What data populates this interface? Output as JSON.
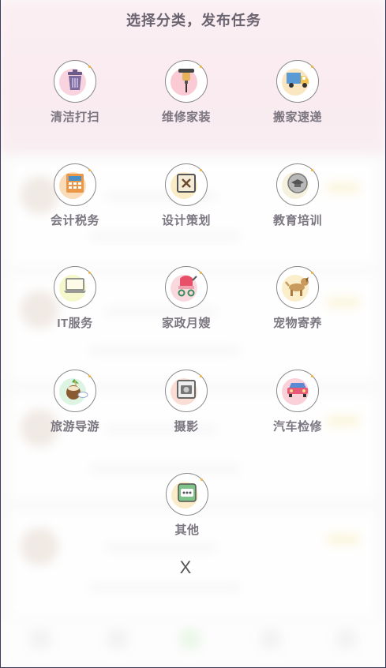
{
  "title": "选择分类，发布任务",
  "categories": [
    {
      "label": "清洁打扫",
      "icon": "trash-can-icon",
      "glow": "#f5b5c8"
    },
    {
      "label": "维修家装",
      "icon": "drill-icon",
      "glow": "#f7a8b8"
    },
    {
      "label": "搬家速递",
      "icon": "moving-truck-icon",
      "glow": "#f7d79a"
    },
    {
      "label": "会计税务",
      "icon": "calculator-icon",
      "glow": "#f7c58a"
    },
    {
      "label": "设计策划",
      "icon": "design-board-icon",
      "glow": "#f7e1a0"
    },
    {
      "label": "教育培训",
      "icon": "graduation-cap-icon",
      "glow": "#f0e7c8"
    },
    {
      "label": "IT服务",
      "icon": "laptop-icon",
      "glow": "#eef3a8"
    },
    {
      "label": "家政月嫂",
      "icon": "baby-stroller-icon",
      "glow": "#f7c0c8"
    },
    {
      "label": "宠物寄养",
      "icon": "dog-icon",
      "glow": "#f7e3a8"
    },
    {
      "label": "旅游导游",
      "icon": "coconut-drink-icon",
      "glow": "#c8ecd0"
    },
    {
      "label": "摄影",
      "icon": "camera-icon",
      "glow": "#f7c6b8"
    },
    {
      "label": "汽车检修",
      "icon": "car-icon",
      "glow": "#f7b0c0"
    },
    {
      "label": "其他",
      "icon": "more-dots-icon",
      "glow": "#f6dfa4"
    }
  ],
  "close_label": "X",
  "colors": {
    "accent_pink": "#eab6c9",
    "label_text": "#7b7680"
  }
}
